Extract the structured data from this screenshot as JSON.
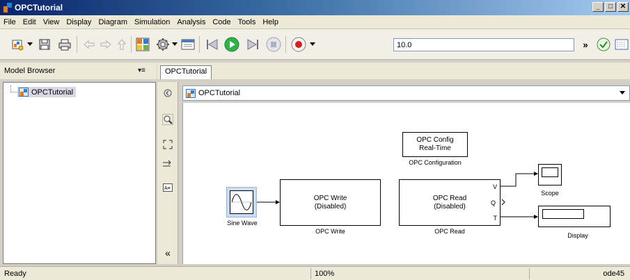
{
  "window": {
    "title": "OPCTutorial"
  },
  "menu": [
    "File",
    "Edit",
    "View",
    "Display",
    "Diagram",
    "Simulation",
    "Analysis",
    "Code",
    "Tools",
    "Help"
  ],
  "toolbar": {
    "stop_time": "10.0"
  },
  "browser": {
    "header": "Model Browser",
    "tree_item": "OPCTutorial"
  },
  "tab": {
    "label": "OPCTutorial"
  },
  "address": {
    "path": "OPCTutorial"
  },
  "blocks": {
    "opc_config": {
      "line1": "OPC Config",
      "line2": "Real-Time",
      "caption": "OPC Configuration"
    },
    "sine_wave": {
      "caption": "Sine Wave"
    },
    "opc_write": {
      "line1": "OPC Write",
      "line2": "(Disabled)",
      "caption": "OPC Write"
    },
    "opc_read": {
      "line1": "OPC Read",
      "line2": "(Disabled)",
      "caption": "OPC Read",
      "port_v": "V",
      "port_q": "Q",
      "port_t": "T"
    },
    "scope": {
      "caption": "Scope"
    },
    "display": {
      "caption": "Display"
    }
  },
  "status": {
    "left": "Ready",
    "zoom": "100%",
    "solver": "ode45"
  },
  "colors": {
    "title_start": "#0a246a",
    "title_end": "#a6caf0",
    "run_green": "#2fb24a",
    "record_red": "#d42020"
  }
}
